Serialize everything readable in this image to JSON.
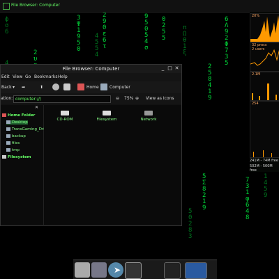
{
  "topbar": {
    "title": "File Browser: Computer"
  },
  "rain": {
    "c1": "ϕ\nσ\n6\n\n\n\n\n4\n5\nπ",
    "c2": "2\nυ\nφ\nσ",
    "c3": "3\nΨ\n1\n9\n5\n0",
    "c4": "2\n9\n0\nε\n6\nτ",
    "c5": "4\n5\n5\n4",
    "c6": "9\n5\n0\n5\n4\nσ",
    "c7": "0\n2\n5\n5",
    "c8": "π\nΩ\nθ\n1\nξ",
    "c9": "2\n5\n8\n4\n1\n9",
    "c10": "6\nΛ\n9\n2\nΦ\n7\n3\n5",
    "c11": "5\nΣ\n8\n2\n1\n9",
    "c12": "7\n3\n1\nφ\n6\n4\n8",
    "c13": "1\n4\n5\n9",
    "c14": "5\n0\n2\n8\n3"
  },
  "monitor": {
    "cpu": "20%",
    "procs": "32 procs",
    "users": "2 users",
    "net": "2.1M",
    "disk": "254",
    "mem1": "241M - 74M free",
    "mem2": "502M - 500M free"
  },
  "window": {
    "title": "File Browser: Computer",
    "menus": [
      "Edit",
      "View",
      "Go",
      "Bookmarks",
      "Help"
    ],
    "toolbar": {
      "back": "Back",
      "home": "Home",
      "computer": "Computer"
    },
    "location": {
      "label": "ation:",
      "value": "computer:///",
      "zoom": "75%",
      "view_mode": "View as Icons"
    },
    "sidebar": [
      "Home Folder",
      "Desktop",
      "TransGaming_Drive",
      "backup",
      "files",
      "tmp",
      "Filesystem"
    ],
    "items": [
      "CD-ROM",
      "Filesystem",
      "Network"
    ]
  },
  "colors": {
    "accent": "#00ff44",
    "bg": "#000000",
    "panel": "#111111"
  }
}
